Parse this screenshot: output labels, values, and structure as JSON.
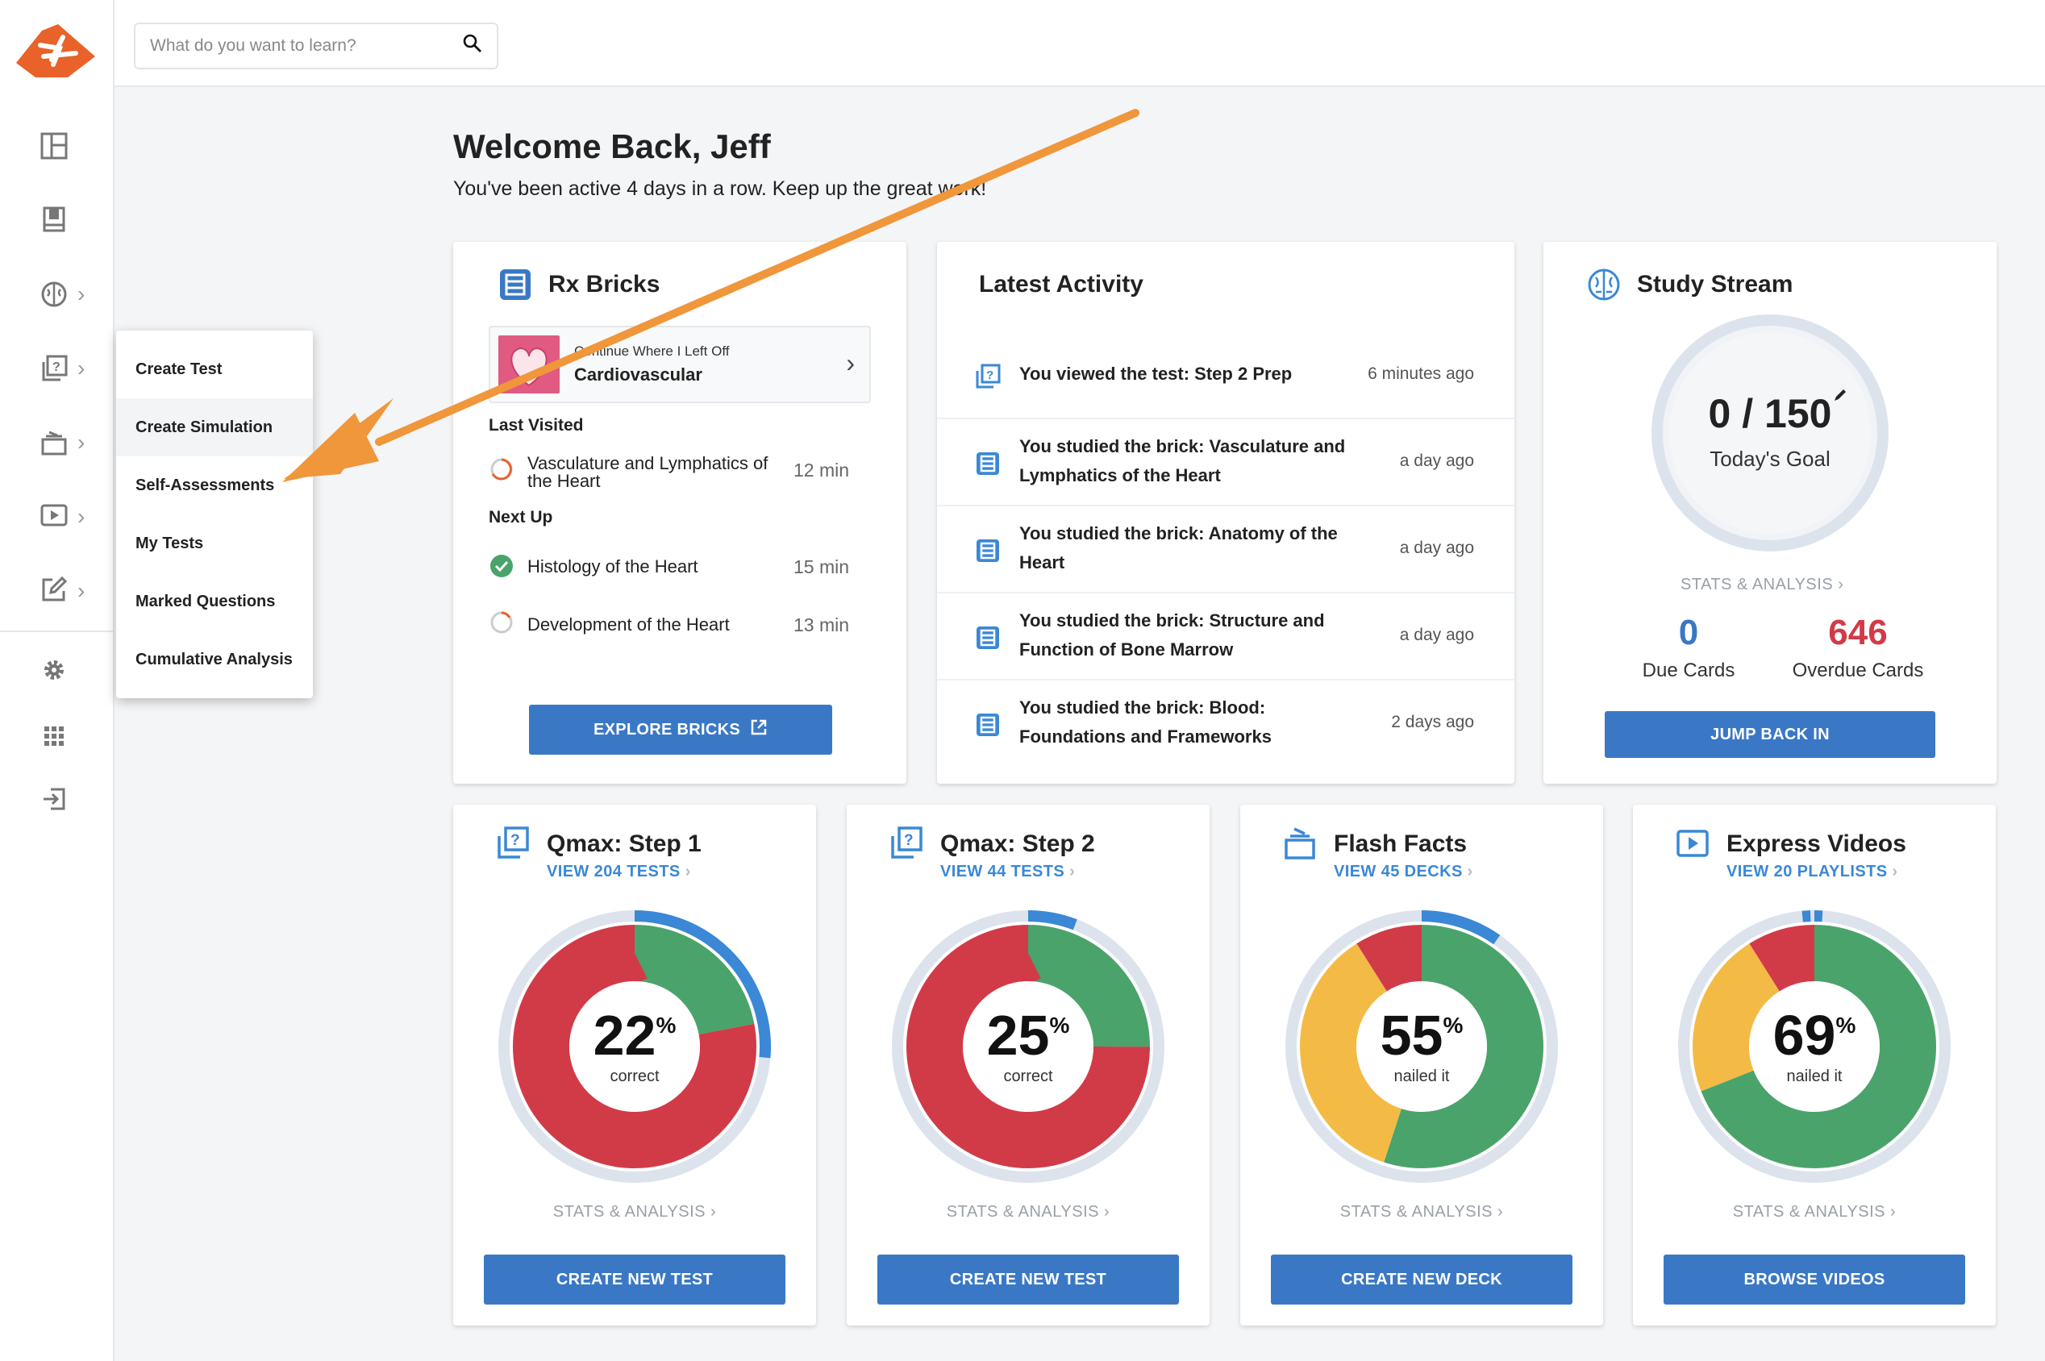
{
  "search": {
    "placeholder": "What do you want to learn?"
  },
  "menu": {
    "items": [
      "Create Test",
      "Create Simulation",
      "Self-Assessments",
      "My Tests",
      "Marked Questions",
      "Cumulative Analysis"
    ]
  },
  "welcome": {
    "title": "Welcome Back, Jeff",
    "subtitle": "You've been active 4 days in a row.  Keep up the great work!"
  },
  "bricks": {
    "title": "Rx Bricks",
    "continue_label": "Continue Where I Left Off",
    "continue_value": "Cardiovascular",
    "last_visited_label": "Last Visited",
    "last_item": "Vasculature and Lymphatics of the Heart",
    "last_time": "12 min",
    "next_label": "Next Up",
    "next": [
      {
        "label": "Histology of the Heart",
        "time": "15 min",
        "done": true
      },
      {
        "label": "Development of the Heart",
        "time": "13 min",
        "done": false
      }
    ],
    "button": "EXPLORE BRICKS"
  },
  "activity": {
    "title": "Latest Activity",
    "items": [
      {
        "text": "You viewed the test: Step 2 Prep",
        "time": "6 minutes ago",
        "icon": "test-icon"
      },
      {
        "text": "You studied the brick: Vasculature and Lymphatics of the Heart",
        "time": "a day ago",
        "icon": "brick-icon"
      },
      {
        "text": "You studied the brick: Anatomy of the Heart",
        "time": "a day ago",
        "icon": "brick-icon"
      },
      {
        "text": "You studied the brick: Structure and Function of Bone Marrow",
        "time": "a day ago",
        "icon": "brick-icon"
      },
      {
        "text": "You studied the brick: Blood: Foundations and Frameworks",
        "time": "2 days ago",
        "icon": "brick-icon"
      }
    ]
  },
  "stream": {
    "title": "Study Stream",
    "goal_value": "0 / 150",
    "goal_label": "Today's Goal",
    "stats": "STATS & ANALYSIS",
    "due_value": "0",
    "due_label": "Due Cards",
    "overdue_value": "646",
    "overdue_label": "Overdue Cards",
    "button": "JUMP BACK IN"
  },
  "cards": [
    {
      "title": "Qmax: Step 1",
      "link": "VIEW 204 TESTS",
      "pct": "22",
      "sub": "correct",
      "stats": "STATS & ANALYSIS",
      "button": "CREATE NEW TEST",
      "segments": [
        {
          "value": 0.22,
          "color": "#4aa36b"
        },
        {
          "value": 0.78,
          "color": "#d13b47"
        }
      ],
      "progress": 0.27
    },
    {
      "title": "Qmax: Step 2",
      "link": "VIEW 44 TESTS",
      "pct": "25",
      "sub": "correct",
      "stats": "STATS & ANALYSIS",
      "button": "CREATE NEW TEST",
      "segments": [
        {
          "value": 0.25,
          "color": "#4aa36b"
        },
        {
          "value": 0.75,
          "color": "#d13b47"
        }
      ],
      "progress": 0.06
    },
    {
      "title": "Flash Facts",
      "link": "VIEW 45 DECKS",
      "pct": "55",
      "sub": "nailed it",
      "stats": "STATS & ANALYSIS",
      "button": "CREATE NEW DECK",
      "segments": [
        {
          "value": 0.55,
          "color": "#4aa36b"
        },
        {
          "value": 0.36,
          "color": "#f3bb45"
        },
        {
          "value": 0.09,
          "color": "#d13b47"
        }
      ],
      "progress": 0.1
    },
    {
      "title": "Express Videos",
      "link": "VIEW 20 PLAYLISTS",
      "pct": "69",
      "sub": "nailed it",
      "stats": "STATS & ANALYSIS",
      "button": "BROWSE VIDEOS",
      "segments": [
        {
          "value": 0.69,
          "color": "#4aa36b"
        },
        {
          "value": 0.22,
          "color": "#f3bb45"
        },
        {
          "value": 0.09,
          "color": "#d13b47"
        }
      ],
      "progress": 0.01
    }
  ],
  "colors": {
    "accent": "#3a78c6",
    "brand": "#e8622a",
    "green": "#4aa36b",
    "red": "#d13b47",
    "yellow": "#f3bb45",
    "arrow": "#f0963b"
  }
}
